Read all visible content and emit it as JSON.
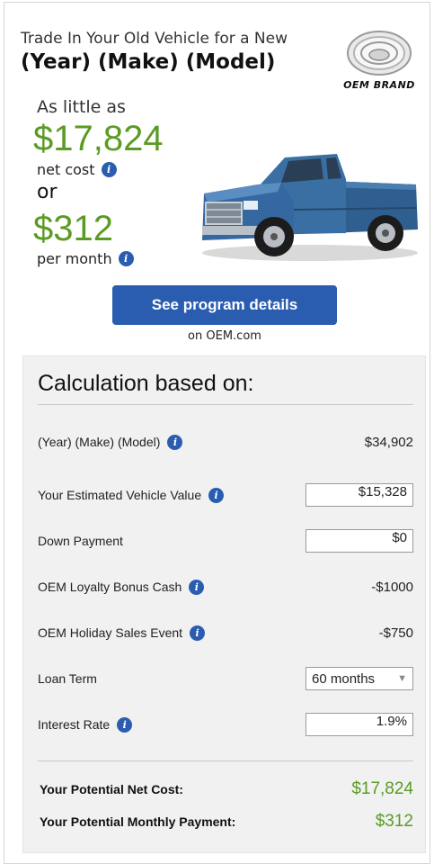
{
  "header": {
    "tagline": "Trade In Your Old Vehicle for a New",
    "vehicle": "(Year) (Make) (Model)",
    "brand_name": "OEM BRAND"
  },
  "offer": {
    "intro": "As little as",
    "net_cost_amount": "$17,824",
    "net_cost_label": "net cost",
    "or_label": "or",
    "monthly_amount": "$312",
    "monthly_label": "per month",
    "info_glyph": "i"
  },
  "cta": {
    "button_label": "See program details",
    "sub_label": "on OEM.com"
  },
  "calculator": {
    "title": "Calculation based on:",
    "rows": [
      {
        "label": "(Year) (Make) (Model)",
        "value": "$34,902",
        "info": true,
        "type": "static"
      },
      {
        "label": "Your Estimated Vehicle Value",
        "value": "$15,328",
        "info": true,
        "type": "input"
      },
      {
        "label": "Down Payment",
        "value": "$0",
        "info": false,
        "type": "input"
      },
      {
        "label": "OEM Loyalty Bonus Cash",
        "value": "-$1000",
        "info": true,
        "type": "static"
      },
      {
        "label": "OEM Holiday Sales Event",
        "value": "-$750",
        "info": true,
        "type": "static"
      },
      {
        "label": "Loan Term",
        "value": "60 months",
        "info": false,
        "type": "select"
      },
      {
        "label": "Interest Rate",
        "value": "1.9%",
        "info": true,
        "type": "input"
      }
    ],
    "totals": [
      {
        "label": "Your Potential Net Cost:",
        "value": "$17,824"
      },
      {
        "label": "Your Potential Monthly Payment:",
        "value": "$312"
      }
    ]
  },
  "colors": {
    "accent_blue": "#2a5db0",
    "price_green": "#5a9b24",
    "panel_bg": "#f1f1f1"
  },
  "icons": {
    "info": "info-icon",
    "select_arrow": "chevron-down-icon",
    "brand_logo": "brand-logo-icon",
    "truck": "pickup-truck-image"
  }
}
